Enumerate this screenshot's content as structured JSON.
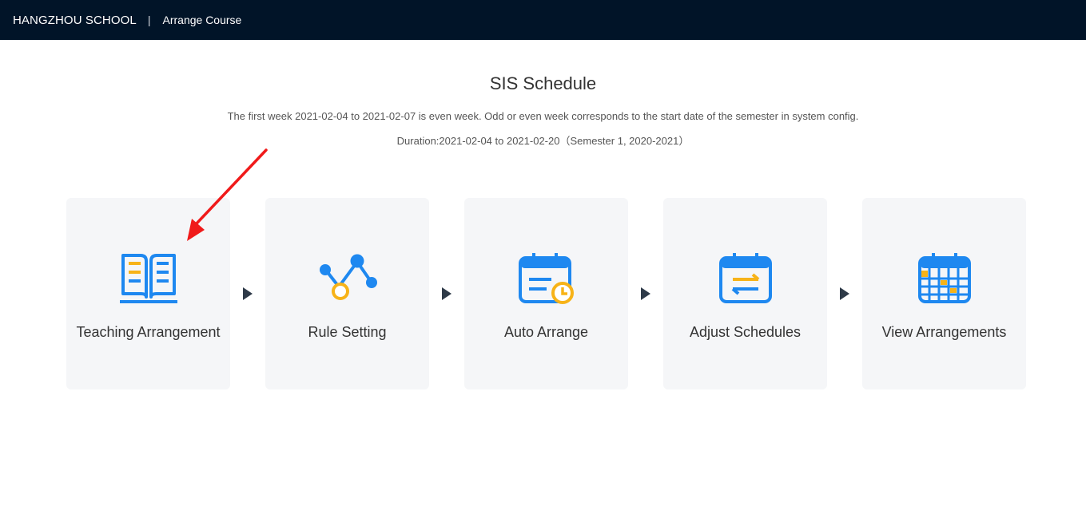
{
  "header": {
    "school": "HANGZHOU SCHOOL",
    "separator": "|",
    "module": "Arrange Course"
  },
  "main": {
    "title": "SIS Schedule",
    "note": "The first week 2021-02-04 to 2021-02-07 is even week. Odd or even week corresponds to the start date of the semester in system config.",
    "duration": "Duration:2021-02-04 to 2021-02-20（Semester 1, 2020-2021）"
  },
  "steps": [
    {
      "label": "Teaching Arrangement",
      "icon": "open-book-icon"
    },
    {
      "label": "Rule Setting",
      "icon": "rule-nodes-icon"
    },
    {
      "label": "Auto Arrange",
      "icon": "calendar-clock-icon"
    },
    {
      "label": "Adjust Schedules",
      "icon": "calendar-swap-icon"
    },
    {
      "label": "View Arrangements",
      "icon": "calendar-grid-icon"
    }
  ],
  "colors": {
    "topbar": "#011428",
    "icon_blue": "#1e88f0",
    "icon_yellow": "#f7b318",
    "card_bg": "#f5f6f8",
    "annotation": "#f01a1a"
  }
}
